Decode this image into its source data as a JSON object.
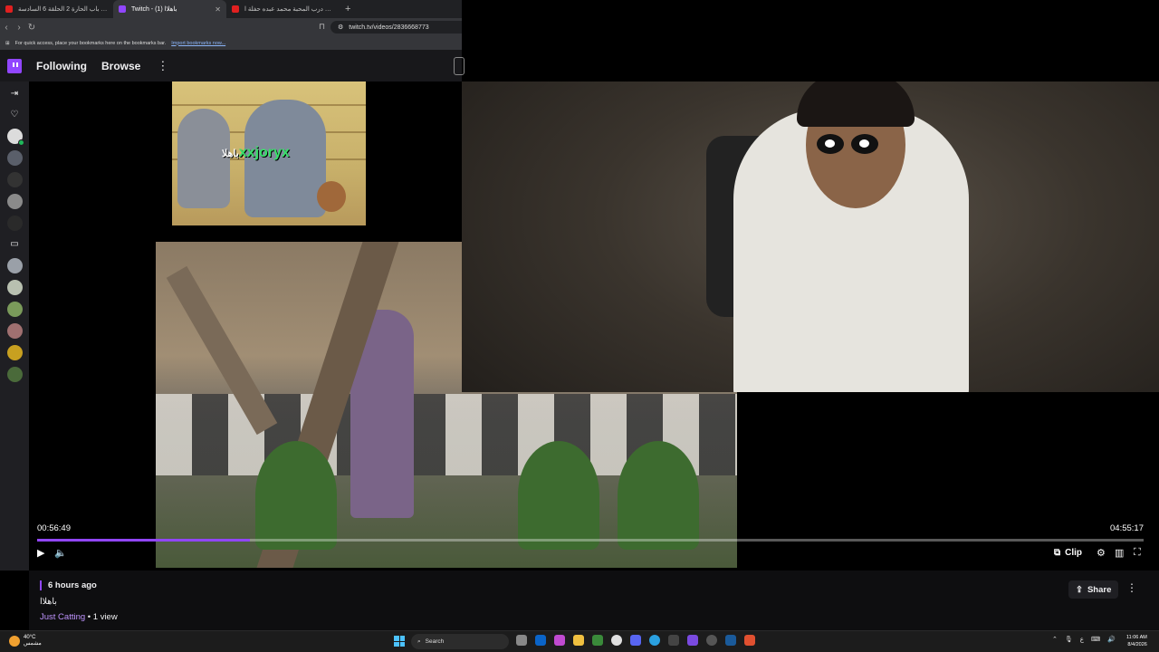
{
  "browser": {
    "tabs": [
      {
        "title": "مسلسل باب الحارة 2 الحلقة 6 السادسة",
        "favicon_color": "#e02020",
        "active": false
      },
      {
        "title": "Twitch - باهلاا (1)",
        "favicon_color": "#9146ff",
        "active": true
      },
      {
        "title": "وينك ي درب المحبة محمد عبده حفلة ا...",
        "favicon_color": "#e02020",
        "active": false
      }
    ],
    "url": "twitch.tv/videos/2836668773",
    "bookmarks_hint": "For quick access, place your bookmarks here on the bookmarks bar.",
    "import_link": "Import bookmarks now..."
  },
  "twitch_nav": {
    "following": "Following",
    "browse": "Browse"
  },
  "overlay": {
    "watermark_arabic": "باهلا",
    "watermark_name": "xxjoryx"
  },
  "player": {
    "current_time": "00:56:49",
    "duration": "04:55:17",
    "progress": 0.192,
    "clip_label": "Clip"
  },
  "video_info": {
    "posted": "6 hours ago",
    "title": "باهلاا",
    "category": "Just Catting",
    "views": " • 1 view",
    "share_label": "Share"
  },
  "taskbar": {
    "temperature": "40°C",
    "weather_desc": "مشمس",
    "search_placeholder": "Search",
    "time": "11:06 AM",
    "date": "8/4/2026",
    "ime": "ع"
  },
  "colors": {
    "brand": "#9146ff",
    "category_link": "#bf94ff"
  }
}
